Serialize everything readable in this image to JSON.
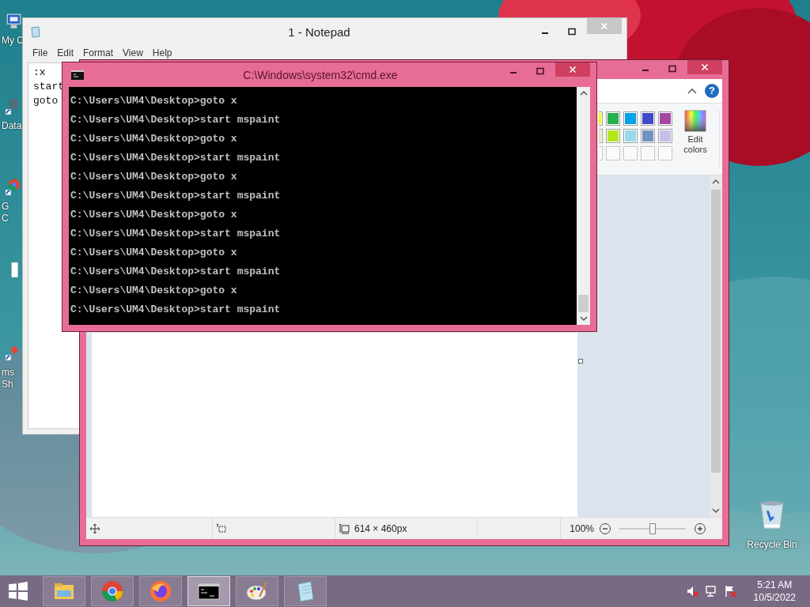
{
  "desktop": {
    "icons": [
      {
        "kind": "computer",
        "lines": [
          "My C"
        ]
      },
      {
        "kind": "shortcut",
        "lines": [
          "Data"
        ]
      },
      {
        "kind": "chrome",
        "lines": [
          "G",
          "C"
        ]
      },
      {
        "kind": "document"
      },
      {
        "kind": "app",
        "lines": [
          "ms",
          "Sh"
        ]
      }
    ],
    "recycle_bin": {
      "label": "Recycle Bin"
    }
  },
  "notepad": {
    "title": "1 - Notepad",
    "menu": [
      "File",
      "Edit",
      "Format",
      "View",
      "Help"
    ],
    "lines": [
      ":x",
      "start",
      "goto"
    ]
  },
  "paint": {
    "ribbon": {
      "help": "?",
      "palette": [
        [
          {
            "kind": "color",
            "color": "#fff200"
          },
          {
            "kind": "color",
            "color": "#22b14c"
          },
          {
            "kind": "color",
            "color": "#00a2e8"
          },
          {
            "kind": "color",
            "color": "#3f48cc"
          },
          {
            "kind": "color",
            "color": "#a349a4"
          }
        ],
        [
          {
            "kind": "color",
            "color": "#efe4b0"
          },
          {
            "kind": "color",
            "color": "#b5e61d"
          },
          {
            "kind": "color",
            "color": "#99d9ea"
          },
          {
            "kind": "color",
            "color": "#7092be"
          },
          {
            "kind": "color",
            "color": "#c8bfe7"
          }
        ],
        [
          {
            "kind": "empty"
          },
          {
            "kind": "empty"
          },
          {
            "kind": "empty"
          },
          {
            "kind": "empty"
          },
          {
            "kind": "empty"
          }
        ]
      ],
      "edit_colors": "Edit colors"
    },
    "status_bar": {
      "dimensions": "614 × 460px",
      "zoom": "100%",
      "zoom_slider": {
        "level": 0.5
      }
    }
  },
  "cmd": {
    "title": "C:\\Windows\\system32\\cmd.exe",
    "lines": [
      "C:\\Users\\UM4\\Desktop>goto x",
      "C:\\Users\\UM4\\Desktop>start mspaint",
      "C:\\Users\\UM4\\Desktop>goto x",
      "C:\\Users\\UM4\\Desktop>start mspaint",
      "C:\\Users\\UM4\\Desktop>goto x",
      "C:\\Users\\UM4\\Desktop>start mspaint",
      "C:\\Users\\UM4\\Desktop>goto x",
      "C:\\Users\\UM4\\Desktop>start mspaint",
      "C:\\Users\\UM4\\Desktop>goto x",
      "C:\\Users\\UM4\\Desktop>start mspaint",
      "C:\\Users\\UM4\\Desktop>goto x",
      "C:\\Users\\UM4\\Desktop>start mspaint"
    ]
  },
  "taskbar": {
    "buttons": [
      {
        "kind": "explorer",
        "selected": false
      },
      {
        "kind": "chrome",
        "selected": false
      },
      {
        "kind": "firefox",
        "selected": false
      },
      {
        "kind": "console",
        "selected": true
      },
      {
        "kind": "paint",
        "selected": false
      },
      {
        "kind": "notepad",
        "selected": false
      }
    ],
    "clock": {
      "time": "5:21 AM",
      "date": "10/5/2022"
    }
  }
}
